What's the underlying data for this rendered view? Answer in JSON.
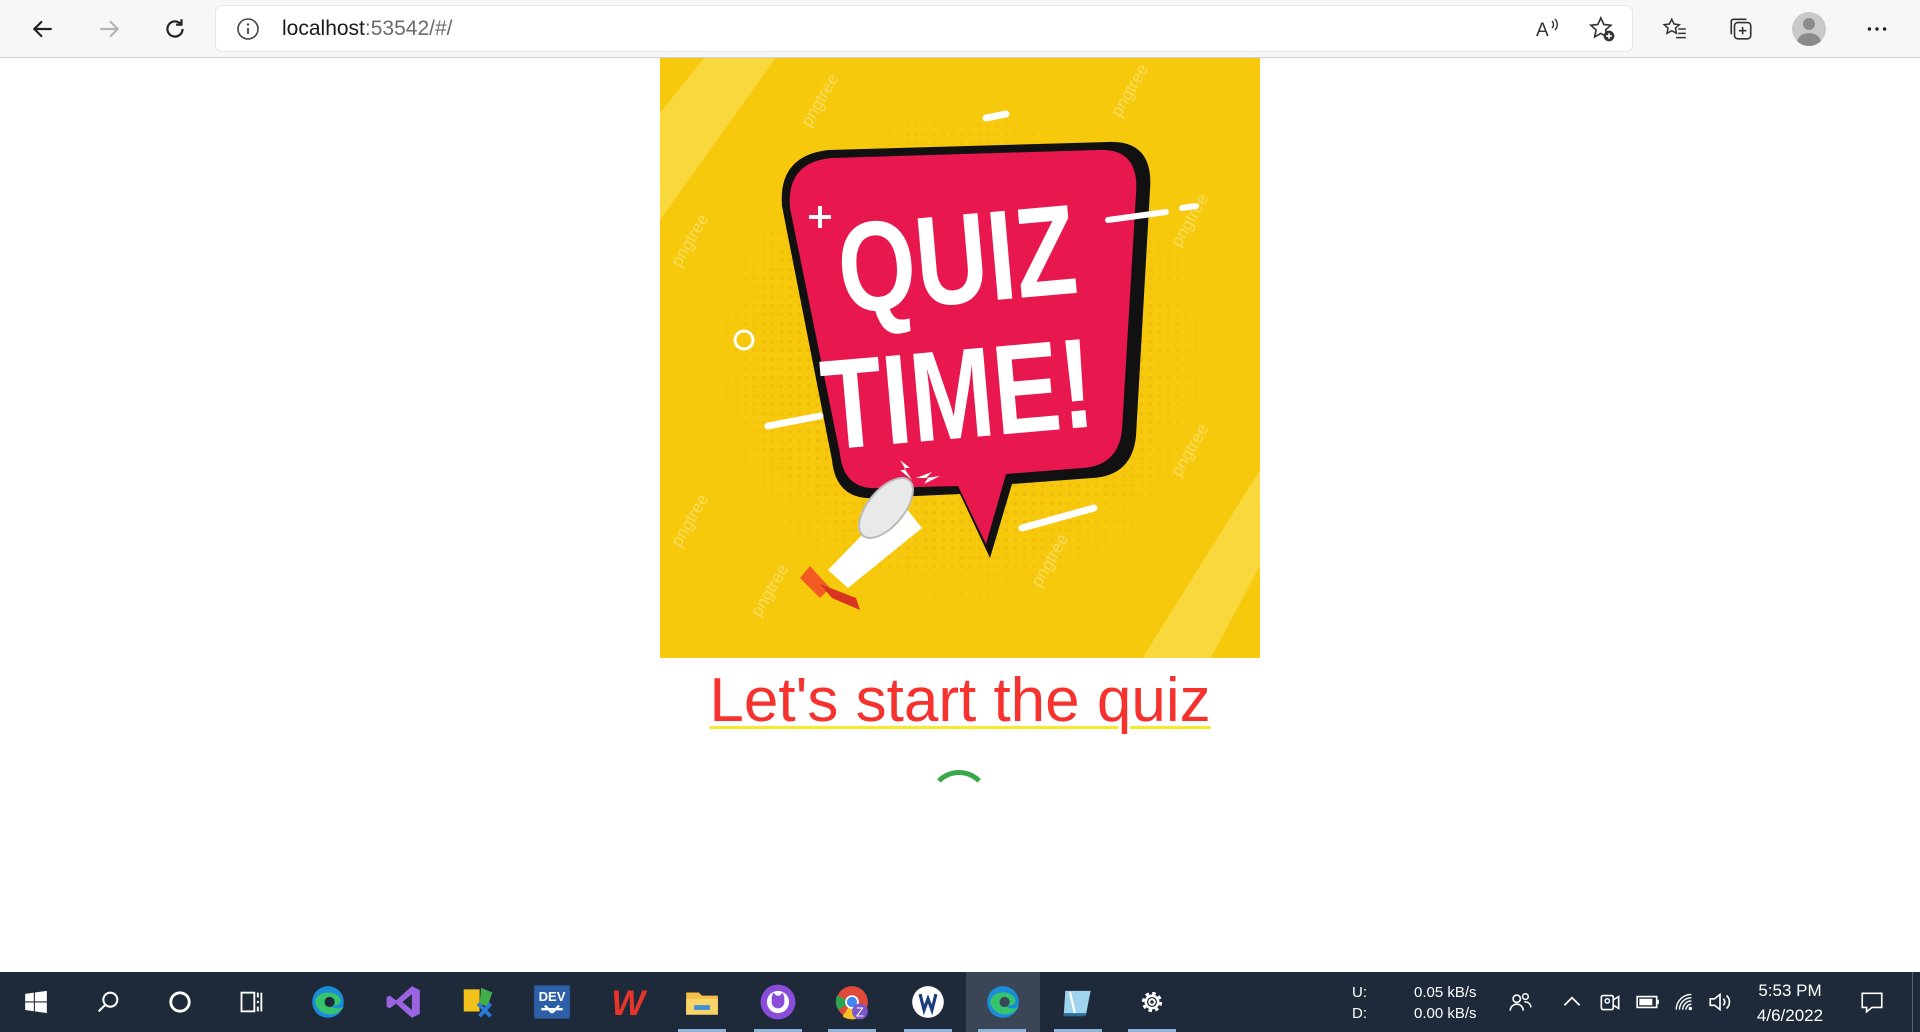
{
  "browser": {
    "url_host": "localhost",
    "url_rest": ":53542/#/"
  },
  "banner": {
    "line1": "QUIZ",
    "line2": "TIME!",
    "watermark": "pngtree",
    "colors": {
      "background": "#f7c90c",
      "bubble": "#e8184e",
      "text": "#ffffff"
    }
  },
  "main": {
    "heading": "Let's start the quiz",
    "heading_color": "#f6322e",
    "spinner_color": "#3aa848"
  },
  "taskbar": {
    "apps": [
      {
        "name": "start",
        "icon": "windows-icon"
      },
      {
        "name": "search",
        "icon": "search-icon"
      },
      {
        "name": "cortana",
        "icon": "cortana-icon"
      },
      {
        "name": "task-view",
        "icon": "task-view-icon"
      },
      {
        "name": "edge",
        "icon": "edge-icon"
      },
      {
        "name": "visual-studio",
        "icon": "visual-studio-icon"
      },
      {
        "name": "app-3",
        "icon": "app-icon"
      },
      {
        "name": "devexpress",
        "icon": "devexpress-icon",
        "label": "DEV"
      },
      {
        "name": "wps-office",
        "icon": "wps-icon",
        "label": "W"
      },
      {
        "name": "file-explorer",
        "icon": "folder-icon"
      },
      {
        "name": "github-desktop",
        "icon": "github-icon"
      },
      {
        "name": "chrome",
        "icon": "chrome-icon"
      },
      {
        "name": "app-12",
        "icon": "app-icon"
      },
      {
        "name": "edge-active",
        "icon": "edge-icon"
      },
      {
        "name": "app-14",
        "icon": "app-icon"
      },
      {
        "name": "settings",
        "icon": "gear-icon"
      }
    ],
    "net_labels": {
      "up": "U:",
      "down": "D:"
    },
    "net_speeds": {
      "up": "0.05 kB/s",
      "down": "0.00 kB/s"
    },
    "time": "5:53 PM",
    "date": "4/6/2022"
  }
}
